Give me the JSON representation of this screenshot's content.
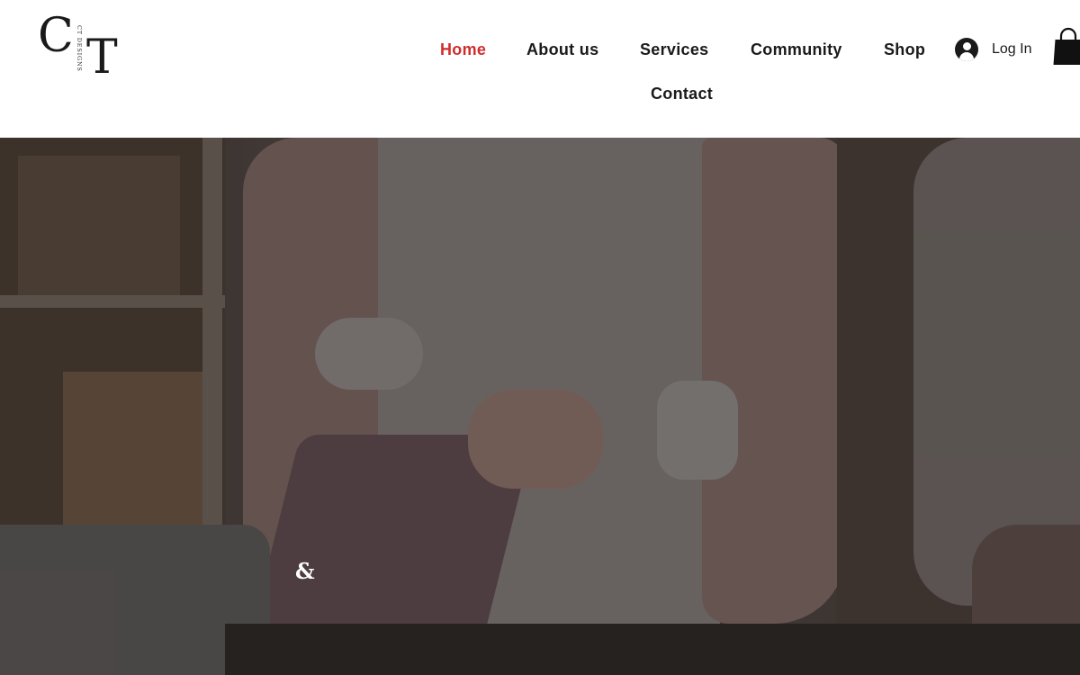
{
  "logo": {
    "letter_c": "C",
    "letter_t": "T",
    "subtitle": "CT DESIGNS"
  },
  "nav": {
    "items": [
      {
        "label": "Home"
      },
      {
        "label": "About us"
      },
      {
        "label": "Services"
      },
      {
        "label": "Community"
      },
      {
        "label": "Shop"
      },
      {
        "label": "Contact"
      }
    ],
    "active_color": "#d12d2d"
  },
  "login": {
    "label": "Log In",
    "icon": "user-avatar-icon"
  },
  "cart": {
    "icon": "shopping-bag-icon"
  },
  "hero": {
    "text": "&"
  }
}
